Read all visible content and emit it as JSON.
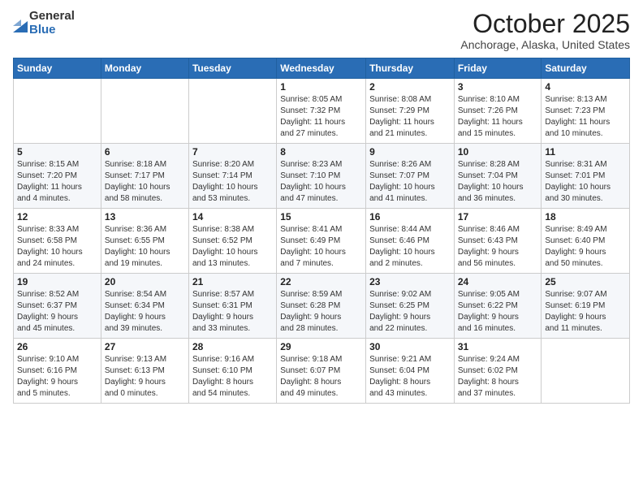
{
  "logo": {
    "general": "General",
    "blue": "Blue"
  },
  "header": {
    "month": "October 2025",
    "location": "Anchorage, Alaska, United States"
  },
  "weekdays": [
    "Sunday",
    "Monday",
    "Tuesday",
    "Wednesday",
    "Thursday",
    "Friday",
    "Saturday"
  ],
  "weeks": [
    [
      {
        "day": "",
        "info": ""
      },
      {
        "day": "",
        "info": ""
      },
      {
        "day": "",
        "info": ""
      },
      {
        "day": "1",
        "info": "Sunrise: 8:05 AM\nSunset: 7:32 PM\nDaylight: 11 hours\nand 27 minutes."
      },
      {
        "day": "2",
        "info": "Sunrise: 8:08 AM\nSunset: 7:29 PM\nDaylight: 11 hours\nand 21 minutes."
      },
      {
        "day": "3",
        "info": "Sunrise: 8:10 AM\nSunset: 7:26 PM\nDaylight: 11 hours\nand 15 minutes."
      },
      {
        "day": "4",
        "info": "Sunrise: 8:13 AM\nSunset: 7:23 PM\nDaylight: 11 hours\nand 10 minutes."
      }
    ],
    [
      {
        "day": "5",
        "info": "Sunrise: 8:15 AM\nSunset: 7:20 PM\nDaylight: 11 hours\nand 4 minutes."
      },
      {
        "day": "6",
        "info": "Sunrise: 8:18 AM\nSunset: 7:17 PM\nDaylight: 10 hours\nand 58 minutes."
      },
      {
        "day": "7",
        "info": "Sunrise: 8:20 AM\nSunset: 7:14 PM\nDaylight: 10 hours\nand 53 minutes."
      },
      {
        "day": "8",
        "info": "Sunrise: 8:23 AM\nSunset: 7:10 PM\nDaylight: 10 hours\nand 47 minutes."
      },
      {
        "day": "9",
        "info": "Sunrise: 8:26 AM\nSunset: 7:07 PM\nDaylight: 10 hours\nand 41 minutes."
      },
      {
        "day": "10",
        "info": "Sunrise: 8:28 AM\nSunset: 7:04 PM\nDaylight: 10 hours\nand 36 minutes."
      },
      {
        "day": "11",
        "info": "Sunrise: 8:31 AM\nSunset: 7:01 PM\nDaylight: 10 hours\nand 30 minutes."
      }
    ],
    [
      {
        "day": "12",
        "info": "Sunrise: 8:33 AM\nSunset: 6:58 PM\nDaylight: 10 hours\nand 24 minutes."
      },
      {
        "day": "13",
        "info": "Sunrise: 8:36 AM\nSunset: 6:55 PM\nDaylight: 10 hours\nand 19 minutes."
      },
      {
        "day": "14",
        "info": "Sunrise: 8:38 AM\nSunset: 6:52 PM\nDaylight: 10 hours\nand 13 minutes."
      },
      {
        "day": "15",
        "info": "Sunrise: 8:41 AM\nSunset: 6:49 PM\nDaylight: 10 hours\nand 7 minutes."
      },
      {
        "day": "16",
        "info": "Sunrise: 8:44 AM\nSunset: 6:46 PM\nDaylight: 10 hours\nand 2 minutes."
      },
      {
        "day": "17",
        "info": "Sunrise: 8:46 AM\nSunset: 6:43 PM\nDaylight: 9 hours\nand 56 minutes."
      },
      {
        "day": "18",
        "info": "Sunrise: 8:49 AM\nSunset: 6:40 PM\nDaylight: 9 hours\nand 50 minutes."
      }
    ],
    [
      {
        "day": "19",
        "info": "Sunrise: 8:52 AM\nSunset: 6:37 PM\nDaylight: 9 hours\nand 45 minutes."
      },
      {
        "day": "20",
        "info": "Sunrise: 8:54 AM\nSunset: 6:34 PM\nDaylight: 9 hours\nand 39 minutes."
      },
      {
        "day": "21",
        "info": "Sunrise: 8:57 AM\nSunset: 6:31 PM\nDaylight: 9 hours\nand 33 minutes."
      },
      {
        "day": "22",
        "info": "Sunrise: 8:59 AM\nSunset: 6:28 PM\nDaylight: 9 hours\nand 28 minutes."
      },
      {
        "day": "23",
        "info": "Sunrise: 9:02 AM\nSunset: 6:25 PM\nDaylight: 9 hours\nand 22 minutes."
      },
      {
        "day": "24",
        "info": "Sunrise: 9:05 AM\nSunset: 6:22 PM\nDaylight: 9 hours\nand 16 minutes."
      },
      {
        "day": "25",
        "info": "Sunrise: 9:07 AM\nSunset: 6:19 PM\nDaylight: 9 hours\nand 11 minutes."
      }
    ],
    [
      {
        "day": "26",
        "info": "Sunrise: 9:10 AM\nSunset: 6:16 PM\nDaylight: 9 hours\nand 5 minutes."
      },
      {
        "day": "27",
        "info": "Sunrise: 9:13 AM\nSunset: 6:13 PM\nDaylight: 9 hours\nand 0 minutes."
      },
      {
        "day": "28",
        "info": "Sunrise: 9:16 AM\nSunset: 6:10 PM\nDaylight: 8 hours\nand 54 minutes."
      },
      {
        "day": "29",
        "info": "Sunrise: 9:18 AM\nSunset: 6:07 PM\nDaylight: 8 hours\nand 49 minutes."
      },
      {
        "day": "30",
        "info": "Sunrise: 9:21 AM\nSunset: 6:04 PM\nDaylight: 8 hours\nand 43 minutes."
      },
      {
        "day": "31",
        "info": "Sunrise: 9:24 AM\nSunset: 6:02 PM\nDaylight: 8 hours\nand 37 minutes."
      },
      {
        "day": "",
        "info": ""
      }
    ]
  ]
}
